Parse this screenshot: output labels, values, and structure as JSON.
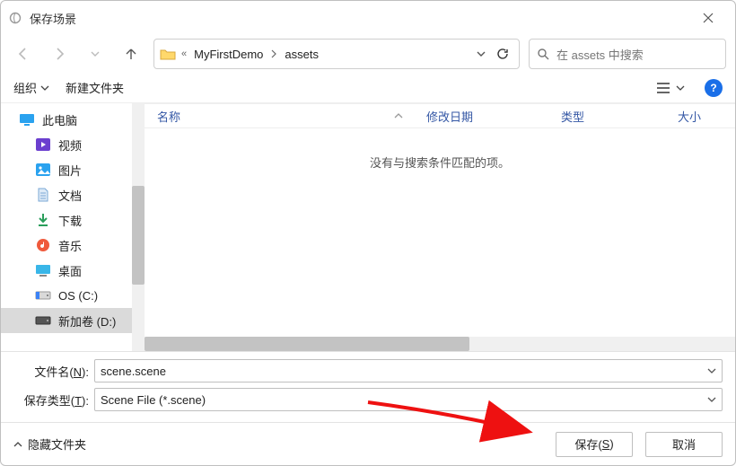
{
  "title": "保存场景",
  "nav": {
    "breadcrumb_prefix": "«",
    "crumb1": "MyFirstDemo",
    "crumb2": "assets"
  },
  "search": {
    "placeholder": "在 assets 中搜索"
  },
  "toolbar": {
    "organize": "组织",
    "newfolder": "新建文件夹"
  },
  "columns": {
    "name": "名称",
    "modified": "修改日期",
    "type": "类型",
    "size": "大小"
  },
  "empty_msg": "没有与搜索条件匹配的项。",
  "sidebar": {
    "items": [
      {
        "label": "此电脑"
      },
      {
        "label": "视频"
      },
      {
        "label": "图片"
      },
      {
        "label": "文档"
      },
      {
        "label": "下载"
      },
      {
        "label": "音乐"
      },
      {
        "label": "桌面"
      },
      {
        "label": "OS (C:)"
      },
      {
        "label": "新加卷 (D:)"
      }
    ]
  },
  "form": {
    "filename_label_pre": "文件名(",
    "filename_label_key": "N",
    "filename_label_post": "):",
    "filename_value": "scene.scene",
    "filetype_label_pre": "保存类型(",
    "filetype_label_key": "T",
    "filetype_label_post": "):",
    "filetype_value": "Scene File (*.scene)"
  },
  "footer": {
    "hide": "隐藏文件夹",
    "save_pre": "保存(",
    "save_key": "S",
    "save_post": ")",
    "cancel": "取消"
  }
}
